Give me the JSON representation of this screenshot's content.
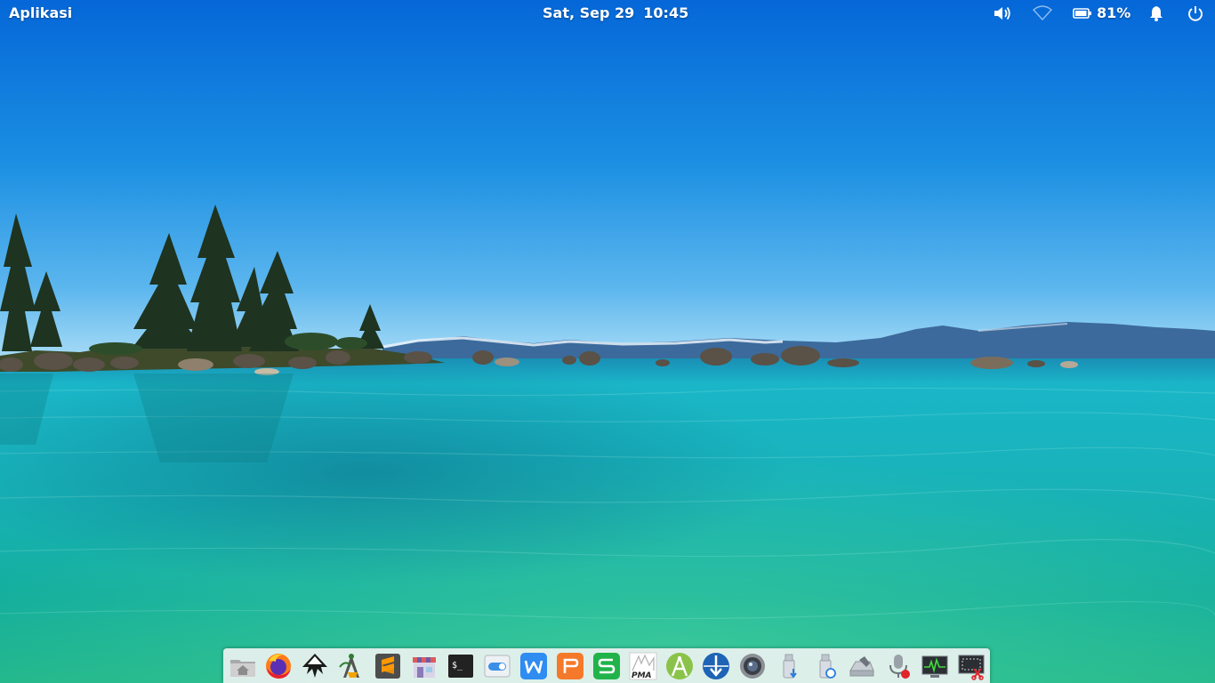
{
  "panel": {
    "apps_label": "Aplikasi",
    "date": "Sat, Sep 29",
    "time": "10:45",
    "battery_percent": "81%",
    "tray_icons": [
      "volume-icon",
      "wifi-icon",
      "battery-icon",
      "notification-bell-icon",
      "power-icon"
    ]
  },
  "dock": {
    "items": [
      {
        "name": "file-manager",
        "icon": "home-folder-icon"
      },
      {
        "name": "firefox",
        "icon": "firefox-icon"
      },
      {
        "name": "inkscape",
        "icon": "inkscape-icon"
      },
      {
        "name": "vector-drawing-app",
        "icon": "compass-pen-icon"
      },
      {
        "name": "sublime-text",
        "icon": "sublime-text-icon"
      },
      {
        "name": "appcenter",
        "icon": "store-icon"
      },
      {
        "name": "terminal",
        "icon": "terminal-icon"
      },
      {
        "name": "settings-toggle",
        "icon": "toggle-switch-icon"
      },
      {
        "name": "wps-writer",
        "icon": "wps-writer-icon"
      },
      {
        "name": "wps-presentation",
        "icon": "wps-presentation-icon"
      },
      {
        "name": "wps-spreadsheets",
        "icon": "wps-spreadsheets-icon"
      },
      {
        "name": "phpmyadmin",
        "icon": "pma-icon"
      },
      {
        "name": "android-studio",
        "icon": "android-studio-icon"
      },
      {
        "name": "downloader",
        "icon": "download-arrow-icon"
      },
      {
        "name": "webcam",
        "icon": "camera-lens-icon"
      },
      {
        "name": "usb-installer",
        "icon": "usb-drive-icon"
      },
      {
        "name": "usb-restore",
        "icon": "usb-restore-icon"
      },
      {
        "name": "disk-utility",
        "icon": "disk-tool-icon"
      },
      {
        "name": "voice-recorder",
        "icon": "microphone-icon"
      },
      {
        "name": "system-monitor",
        "icon": "system-monitor-icon"
      },
      {
        "name": "screenshot-tool",
        "icon": "screenshot-icon"
      }
    ]
  },
  "terminal_prompt": "$_",
  "pma_label": "PMA",
  "colors": {
    "sky_top": "#0a6fd6",
    "sky_horizon": "#8fcff0",
    "water_top": "#1fb8c8",
    "water_bottom": "#12a685",
    "panel_text": "#ffffff",
    "dock_bg": "#f5f5f5"
  }
}
